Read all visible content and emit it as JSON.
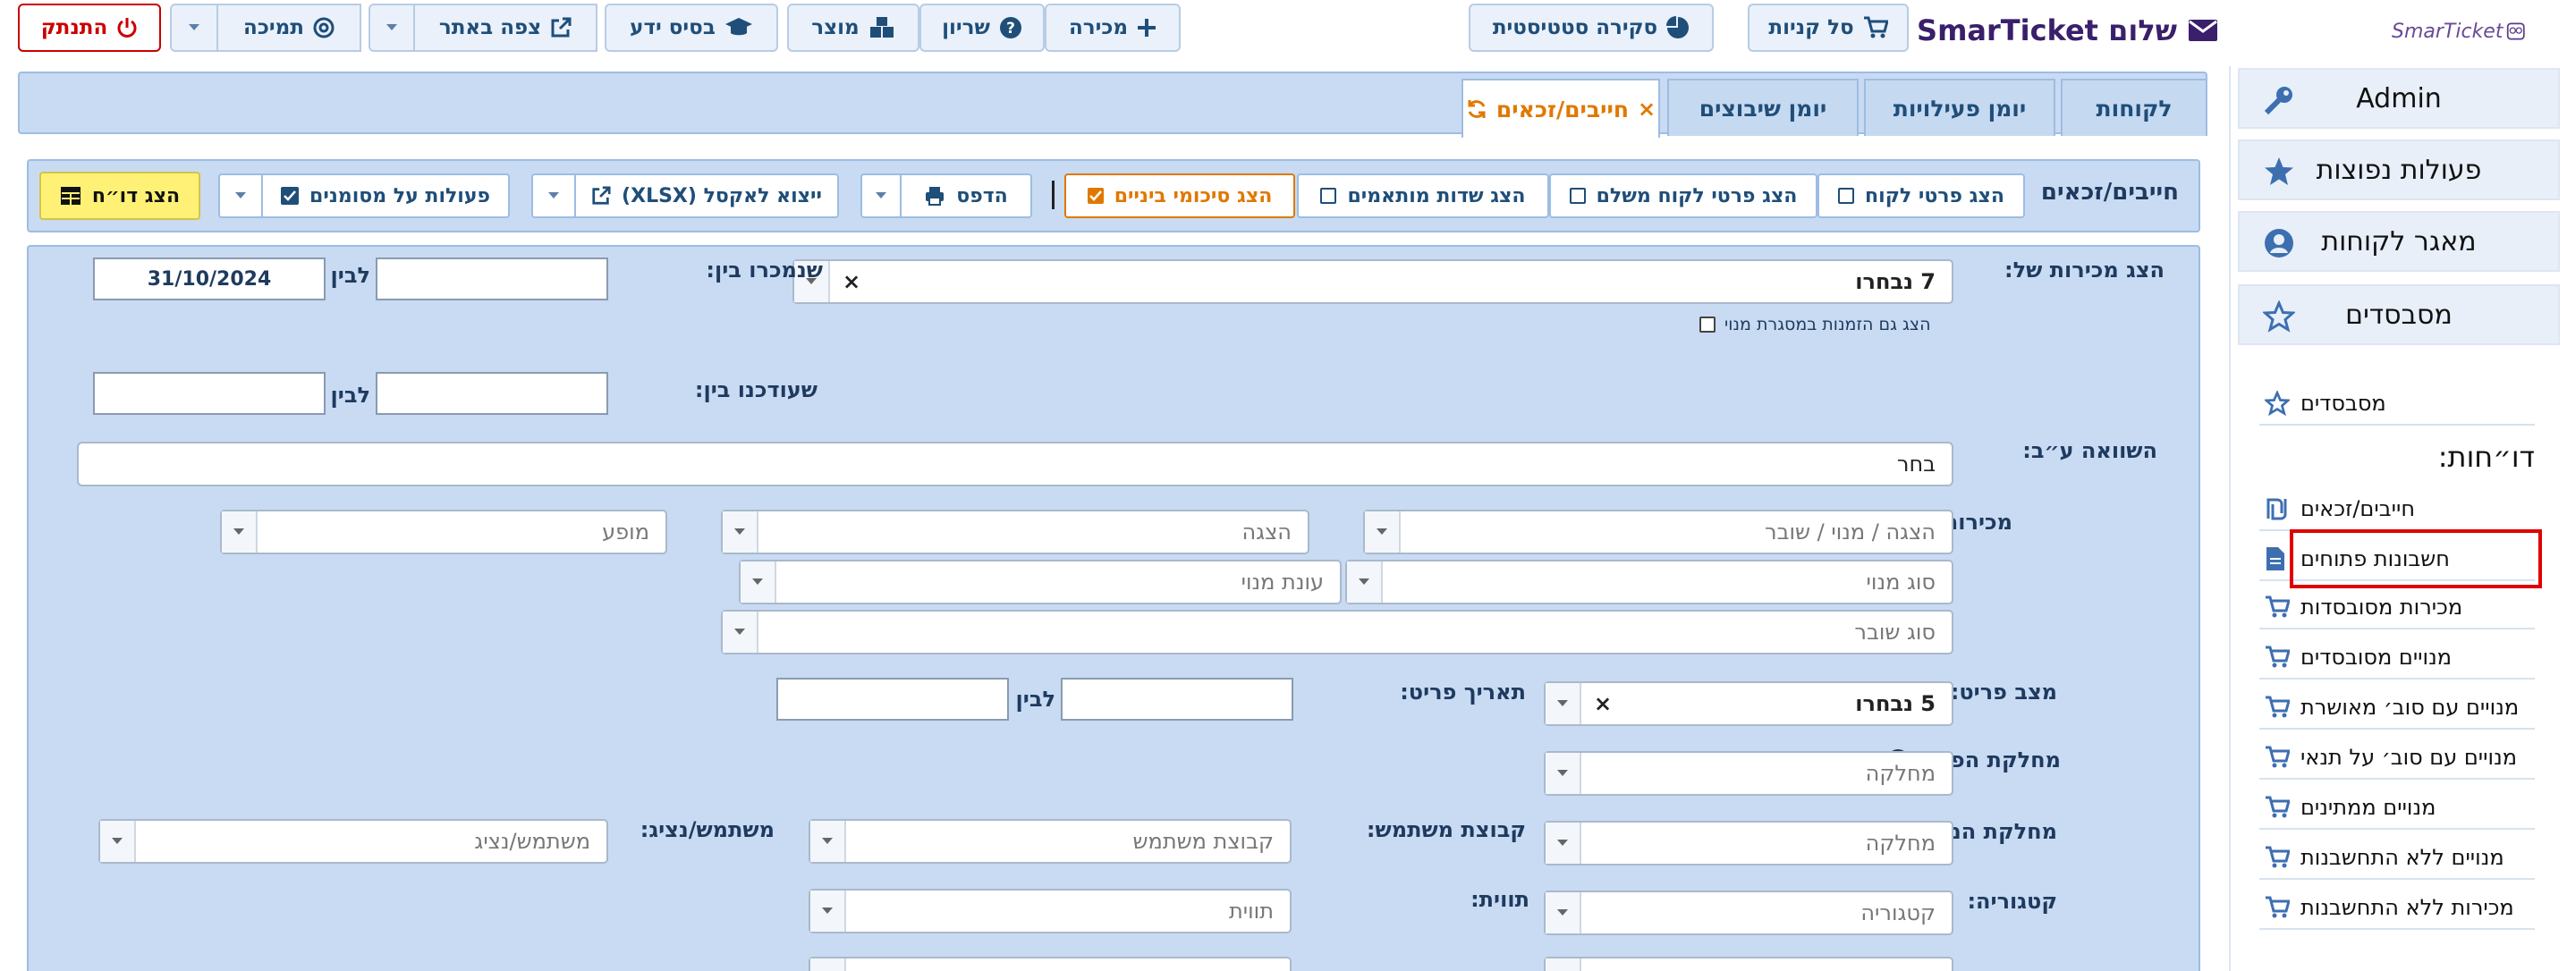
{
  "topbar": {
    "greeting": "שלום SmarTicket",
    "cart": "סל קניות",
    "stats": "סקירה סטטיסטית",
    "sale": "מכירה",
    "reservation": "שריון",
    "product": "מוצר",
    "knowledge": "בסיס ידע",
    "view_site": "צפה באתר",
    "support": "תמיכה",
    "logout": "התנתק",
    "logo": "SmarTicket"
  },
  "sidebar": {
    "main_items": [
      {
        "label": "Admin"
      },
      {
        "label": "פעולות נפוצות"
      },
      {
        "label": "מאגר לקוחות"
      },
      {
        "label": "מסבסדים"
      }
    ],
    "subsidized_link": "מסבסדים",
    "reports_heading": "דו״חות:",
    "reports": [
      {
        "label": "חייבים/זכאים"
      },
      {
        "label": "חשבונות פתוחים"
      },
      {
        "label": "מכירות מסובסדות"
      },
      {
        "label": "מנויים מסובסדים"
      },
      {
        "label": "מנויים עם סוב׳ מאושרת"
      },
      {
        "label": "מנויים עם סוב׳ על תנאי"
      },
      {
        "label": "מנויים ממתינים"
      },
      {
        "label": "מנויים ללא התחשבנות"
      },
      {
        "label": "מכירות ללא התחשבנות"
      }
    ]
  },
  "tabs": [
    {
      "label": "לקוחות"
    },
    {
      "label": "יומן פעילויות"
    },
    {
      "label": "יומן שיבוצים"
    },
    {
      "label": "חייבים/זכאים"
    }
  ],
  "toolbar": {
    "title": "חייבים/זכאים",
    "show_customer": "הצג פרטי לקוח",
    "show_payer": "הצג פרטי לקוח משלם",
    "show_custom": "הצג שדות מותאמים",
    "show_subtotals": "הצג סיכומי ביניים",
    "print": "הדפס",
    "export": "ייצוא לאקסל (XLSX)",
    "bulk": "פעולות על מסומנים",
    "show_report": "הצג דו״ח"
  },
  "filters": {
    "sales_of_label": "הצג מכירות של:",
    "sales_of_value": "7 נבחרו",
    "sold_between_label": "שנמכרו בין:",
    "to_label": "לבין",
    "sold_to_value": "31/10/2024",
    "include_subs": "הצג גם הזמנות במסגרת מנוי",
    "updated_between_label": "שעודכנו בין:",
    "compare_label": "השוואה ע״ב:",
    "compare_value": "בחר",
    "item_sales_label": "מכירות של פריט:",
    "ph_show_sub_ticket": "הצגה / מנוי / שובר",
    "ph_show": "הצגה",
    "ph_performance": "מופע",
    "ph_sub_type": "סוג מנוי",
    "ph_sub_season": "עונת מנוי",
    "ph_voucher_type": "סוג שובר",
    "item_status_label": "מצב פריט:",
    "item_status_value": "5 נבחרו",
    "item_date_label": "תאריך פריט:",
    "item_dept_label": "מחלקת הפריט",
    "ph_dept": "מחלקה",
    "user_dept_label": "מחלקת המשתמש:",
    "user_group_label": "קבוצת משתמש:",
    "ph_user_group": "קבוצת משתמש",
    "user_agent_label": "משתמש/נציג:",
    "ph_user_agent": "משתמש/נציג",
    "category_label": "קטגוריה:",
    "ph_category": "קטגוריה",
    "tag_label": "תווית:",
    "ph_tag": "תווית"
  }
}
